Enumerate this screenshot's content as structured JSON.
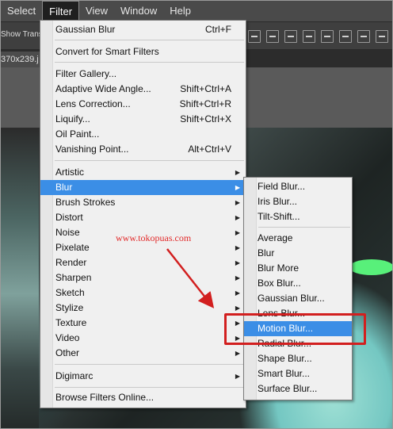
{
  "menubar": {
    "items": [
      {
        "label": "Select"
      },
      {
        "label": "Filter"
      },
      {
        "label": "View"
      },
      {
        "label": "Window"
      },
      {
        "label": "Help"
      }
    ]
  },
  "options_bar": {
    "show_transform_label": "Show Trans"
  },
  "document": {
    "tab_label": "370x239.j"
  },
  "filter_menu": {
    "last_filter": {
      "label": "Gaussian Blur",
      "shortcut": "Ctrl+F"
    },
    "convert": {
      "label": "Convert for Smart Filters"
    },
    "gallery_items": [
      {
        "label": "Filter Gallery...",
        "shortcut": ""
      },
      {
        "label": "Adaptive Wide Angle...",
        "shortcut": "Shift+Ctrl+A"
      },
      {
        "label": "Lens Correction...",
        "shortcut": "Shift+Ctrl+R"
      },
      {
        "label": "Liquify...",
        "shortcut": "Shift+Ctrl+X"
      },
      {
        "label": "Oil Paint...",
        "shortcut": ""
      },
      {
        "label": "Vanishing Point...",
        "shortcut": "Alt+Ctrl+V"
      }
    ],
    "submenus": [
      {
        "label": "Artistic"
      },
      {
        "label": "Blur"
      },
      {
        "label": "Brush Strokes"
      },
      {
        "label": "Distort"
      },
      {
        "label": "Noise"
      },
      {
        "label": "Pixelate"
      },
      {
        "label": "Render"
      },
      {
        "label": "Sharpen"
      },
      {
        "label": "Sketch"
      },
      {
        "label": "Stylize"
      },
      {
        "label": "Texture"
      },
      {
        "label": "Video"
      },
      {
        "label": "Other"
      }
    ],
    "digimarc": {
      "label": "Digimarc"
    },
    "browse": {
      "label": "Browse Filters Online..."
    }
  },
  "blur_menu": {
    "group1": [
      {
        "label": "Field Blur..."
      },
      {
        "label": "Iris Blur..."
      },
      {
        "label": "Tilt-Shift..."
      }
    ],
    "group2": [
      {
        "label": "Average"
      },
      {
        "label": "Blur"
      },
      {
        "label": "Blur More"
      },
      {
        "label": "Box Blur..."
      },
      {
        "label": "Gaussian Blur..."
      },
      {
        "label": "Lens Blur..."
      },
      {
        "label": "Motion Blur..."
      },
      {
        "label": "Radial Blur..."
      },
      {
        "label": "Shape Blur..."
      },
      {
        "label": "Smart Blur..."
      },
      {
        "label": "Surface Blur..."
      }
    ]
  },
  "annotation": {
    "watermark": "www.tokopuas.com",
    "accent_color": "#d21f1f",
    "highlight_color": "#3b8ee6"
  }
}
